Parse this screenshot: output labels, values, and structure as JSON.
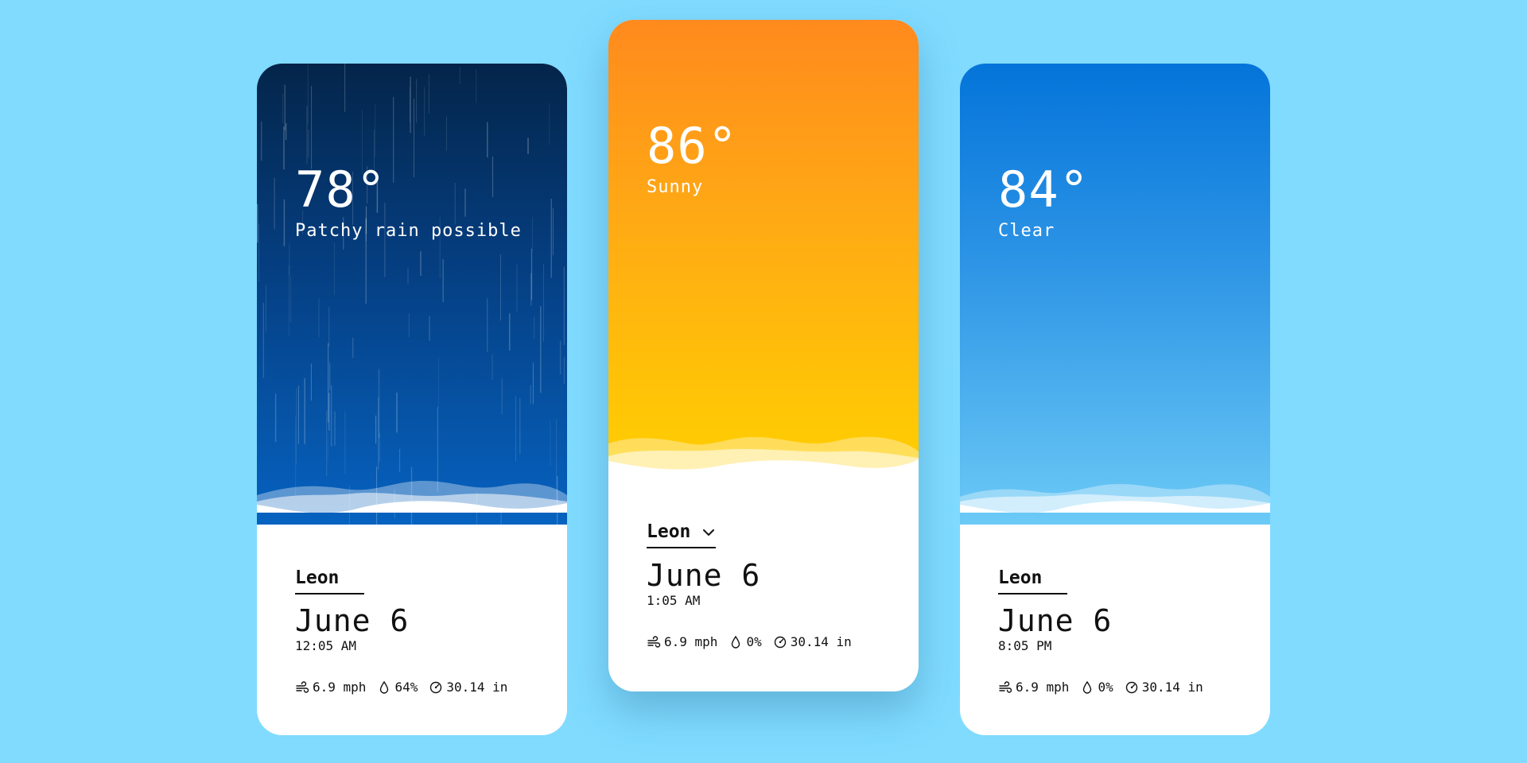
{
  "cards": [
    {
      "temperature": "78°",
      "condition": "Patchy rain possible",
      "city": "Leon",
      "date": "June 6",
      "time": "12:05 AM",
      "wind": "6.9 mph",
      "humidity": "64%",
      "pressure": "30.14 in",
      "theme": "rain",
      "sky_colors": [
        "#04254a",
        "#053f82",
        "#0662c0"
      ]
    },
    {
      "temperature": "86°",
      "condition": "Sunny",
      "city": "Leon",
      "date": "June 6",
      "time": "1:05 AM",
      "wind": "6.9 mph",
      "humidity": "0%",
      "pressure": "30.14 in",
      "theme": "sunny",
      "selected": true,
      "sky_colors": [
        "#ff8a1d",
        "#ffab14",
        "#ffd000"
      ]
    },
    {
      "temperature": "84°",
      "condition": "Clear",
      "city": "Leon",
      "date": "June 6",
      "time": "8:05 PM",
      "wind": "6.9 mph",
      "humidity": "0%",
      "pressure": "30.14 in",
      "theme": "clear",
      "sky_colors": [
        "#0474da",
        "#2f96e6",
        "#6ccaf6"
      ]
    }
  ],
  "icons": {
    "wind": "wind-icon",
    "humidity": "droplet-icon",
    "pressure": "gauge-icon",
    "city_dropdown": "chevron-down-icon"
  },
  "background_color": "#80dbff"
}
